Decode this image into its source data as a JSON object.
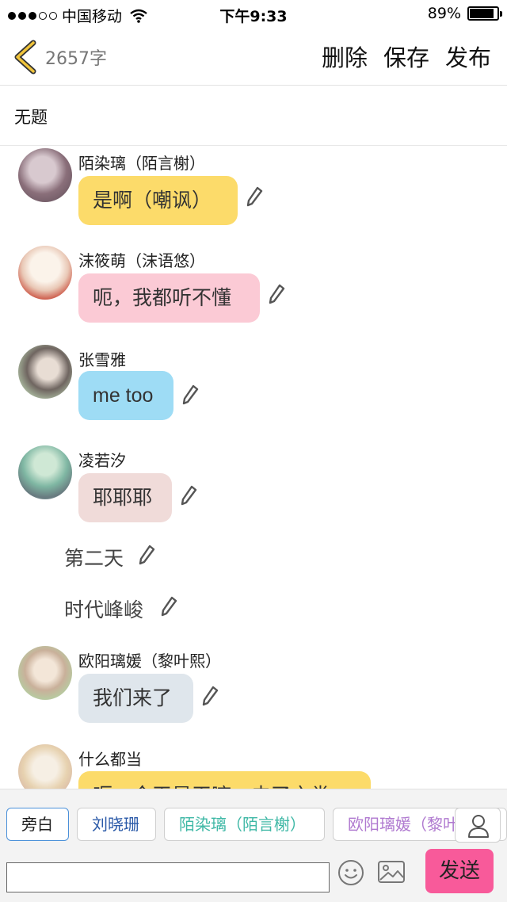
{
  "status_bar": {
    "carrier": "中国移动",
    "time": "下午9:33",
    "battery": "89%",
    "battery_level": 0.89
  },
  "nav": {
    "word_count": "2657字",
    "delete_label": "删除",
    "save_label": "保存",
    "publish_label": "发布",
    "back_icon": "chevron-left-icon"
  },
  "doc": {
    "title": "无题"
  },
  "messages": [
    {
      "type": "dialog",
      "name": "陌染璃（陌言榭）",
      "text": "是啊（嘲讽）",
      "bubble_color": "#fcdb6a"
    },
    {
      "type": "dialog",
      "name": "沫筱萌（沫语悠）",
      "text": "呃，我都听不懂",
      "bubble_color": "#fbcad5"
    },
    {
      "type": "dialog",
      "name": "张雪雅",
      "text": "me too",
      "bubble_color": "#9edcf5"
    },
    {
      "type": "dialog",
      "name": "凌若汐",
      "text": "耶耶耶",
      "bubble_color": "#f0dbd9"
    },
    {
      "type": "narration",
      "text": "第二天"
    },
    {
      "type": "narration",
      "text": "时代峰峻"
    },
    {
      "type": "dialog",
      "name": "欧阳璃媛（黎叶熙）",
      "text": "我们来了",
      "bubble_color": "#dfe6ec"
    },
    {
      "type": "dialog",
      "name": "什么都当",
      "text": "呃，今天是干嘛，去了之类",
      "bubble_color": "#fcdb6a"
    }
  ],
  "roles": [
    {
      "label": "旁白",
      "color": "#222222",
      "selected": true
    },
    {
      "label": "刘晓珊",
      "color": "#2b5aa8",
      "selected": false
    },
    {
      "label": "陌染璃（陌言榭）",
      "color": "#3fb8a6",
      "selected": false
    },
    {
      "label": "欧阳璃媛（黎叶熙）",
      "color": "#b07ad0",
      "selected": false
    }
  ],
  "composer": {
    "input_value": "",
    "send_label": "发送",
    "emoji_icon": "smiley-icon",
    "image_icon": "image-icon",
    "person_icon": "person-icon"
  },
  "colors": {
    "accent": "#f85a9a",
    "back_arrow": "#f0c43b",
    "selected_border": "#4a90d9"
  }
}
